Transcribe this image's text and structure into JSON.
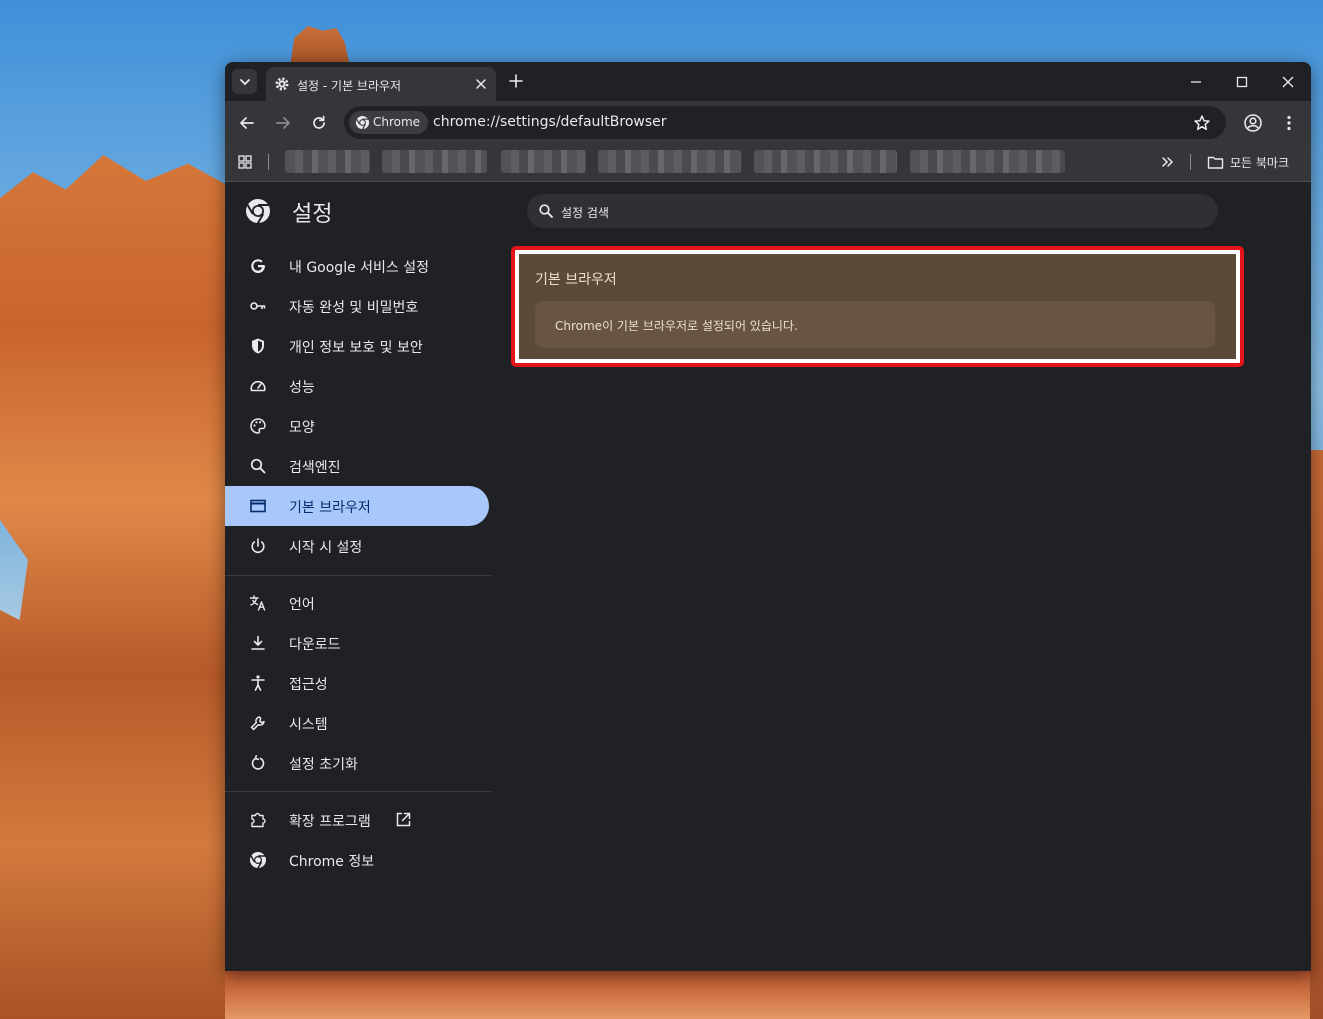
{
  "colors": {
    "window_bg": "#202124",
    "toolbar_bg": "#35363a",
    "active_nav_bg": "#a8c7fa",
    "highlight_border": "#e4141b",
    "card_bg": "#5c4a39"
  },
  "tab": {
    "title": "설정 - 기본 브라우저",
    "icon": "gear-icon"
  },
  "omnibox": {
    "chip_label": "Chrome",
    "url": "chrome://settings/defaultBrowser"
  },
  "bookmarks": {
    "all_bookmarks_label": "모든 북마크"
  },
  "settings": {
    "title": "설정",
    "search_placeholder": "설정 검색",
    "nav": [
      {
        "label": "내 Google 서비스 설정",
        "icon": "google-g-icon"
      },
      {
        "label": "자동 완성 및 비밀번호",
        "icon": "key-icon"
      },
      {
        "label": "개인 정보 보호 및 보안",
        "icon": "shield-icon"
      },
      {
        "label": "성능",
        "icon": "speedometer-icon"
      },
      {
        "label": "모양",
        "icon": "palette-icon"
      },
      {
        "label": "검색엔진",
        "icon": "search-icon"
      },
      {
        "label": "기본 브라우저",
        "icon": "browser-window-icon",
        "active": true
      },
      {
        "label": "시작 시 설정",
        "icon": "power-icon"
      },
      {
        "label": "언어",
        "icon": "translate-icon"
      },
      {
        "label": "다운로드",
        "icon": "download-icon"
      },
      {
        "label": "접근성",
        "icon": "accessibility-icon"
      },
      {
        "label": "시스템",
        "icon": "wrench-icon"
      },
      {
        "label": "설정 초기화",
        "icon": "reset-icon"
      },
      {
        "label": "확장 프로그램",
        "icon": "puzzle-icon"
      },
      {
        "label": "Chrome 정보",
        "icon": "chrome-logo-icon"
      }
    ]
  },
  "default_browser": {
    "section_title": "기본 브라우저",
    "status": "Chrome이 기본 브라우저로 설정되어 있습니다."
  }
}
